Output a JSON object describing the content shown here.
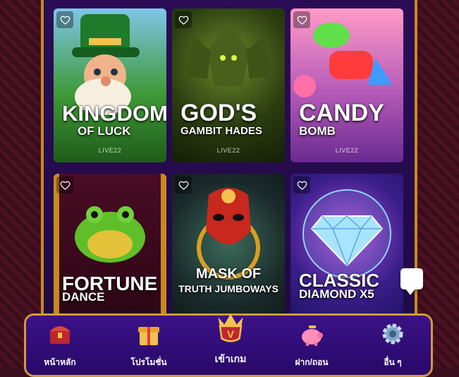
{
  "games": [
    {
      "title_line1": "KINGDOM",
      "title_line2": "OF LUCK",
      "provider": "LIVE22",
      "bg": "#2f8a2a",
      "accent": "#f2c14e"
    },
    {
      "title_line1": "GOD'S",
      "title_line2": "GAMBIT HADES",
      "provider": "LIVE22",
      "bg": "#263d12",
      "accent": "#9acd32"
    },
    {
      "title_line1": "CANDY",
      "title_line2": "BOMB",
      "provider": "LIVE22",
      "bg": "#7b3fb0",
      "accent": "#ff5f9e"
    },
    {
      "title_line1": "FORTUNE",
      "title_line2": "DANCE",
      "provider": "",
      "bg": "#3b0a20",
      "accent": "#7bd13a"
    },
    {
      "title_line1": "MASK OF",
      "title_line2": "TRUTH JUMBOWAYS",
      "provider": "",
      "bg": "#1f3030",
      "accent": "#c8281e"
    },
    {
      "title_line1": "CLASSIC",
      "title_line2": "DIAMOND X5",
      "provider": "",
      "bg": "#2a1a6e",
      "accent": "#8fd6ff"
    }
  ],
  "nav": {
    "home": "หน้าหลัก",
    "promotion": "โปรโมชั่น",
    "enter_game": "เข้าเกม",
    "deposit_withdraw": "ฝาก/ถอน",
    "more": "อื่น ๆ"
  },
  "colors": {
    "frame_gold": "#d49a3c",
    "panel_purple": "#2b0d56",
    "heart": "#ffffff"
  }
}
